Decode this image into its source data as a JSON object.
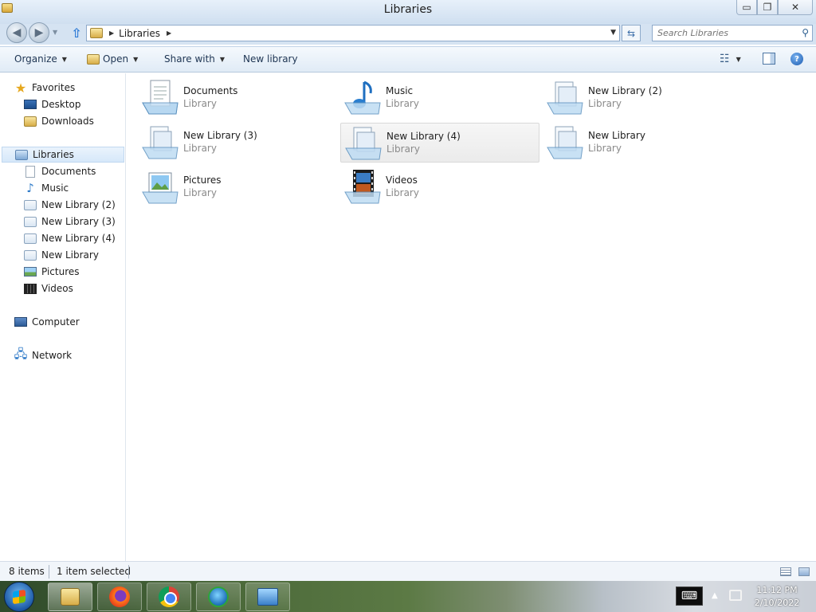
{
  "window": {
    "title": "Libraries"
  },
  "caption": {
    "minimize": "▭",
    "restore": "❐",
    "close": "✕"
  },
  "address": {
    "crumb": "Libraries",
    "search_placeholder": "Search Libraries"
  },
  "commands": {
    "organize": "Organize",
    "open": "Open",
    "share_with": "Share with",
    "new_library": "New library"
  },
  "nav": {
    "favorites": "Favorites",
    "desktop": "Desktop",
    "downloads": "Downloads",
    "libraries": "Libraries",
    "documents": "Documents",
    "music": "Music",
    "new_library_2": "New Library (2)",
    "new_library_3": "New Library (3)",
    "new_library_4": "New Library (4)",
    "new_library": "New Library",
    "pictures": "Pictures",
    "videos": "Videos",
    "computer": "Computer",
    "network": "Network"
  },
  "items": [
    {
      "name": "Documents",
      "type": "Library",
      "icon": "documents-library-icon"
    },
    {
      "name": "Music",
      "type": "Library",
      "icon": "music-library-icon"
    },
    {
      "name": "New Library (2)",
      "type": "Library",
      "icon": "library-icon"
    },
    {
      "name": "New Library (3)",
      "type": "Library",
      "icon": "library-icon"
    },
    {
      "name": "New Library (4)",
      "type": "Library",
      "icon": "library-icon",
      "selected": true
    },
    {
      "name": "New Library",
      "type": "Library",
      "icon": "library-icon"
    },
    {
      "name": "Pictures",
      "type": "Library",
      "icon": "pictures-library-icon"
    },
    {
      "name": "Videos",
      "type": "Library",
      "icon": "videos-library-icon"
    }
  ],
  "status": {
    "count": "8 items",
    "selection": "1 item selected"
  },
  "taskbar": {
    "clock_time": "11:12 PM",
    "clock_date": "2/10/2022"
  },
  "colors": {
    "accent": "#2e7bd6",
    "selection_bg": "#d6e8fa",
    "secondary_text": "#8a8a8a"
  }
}
